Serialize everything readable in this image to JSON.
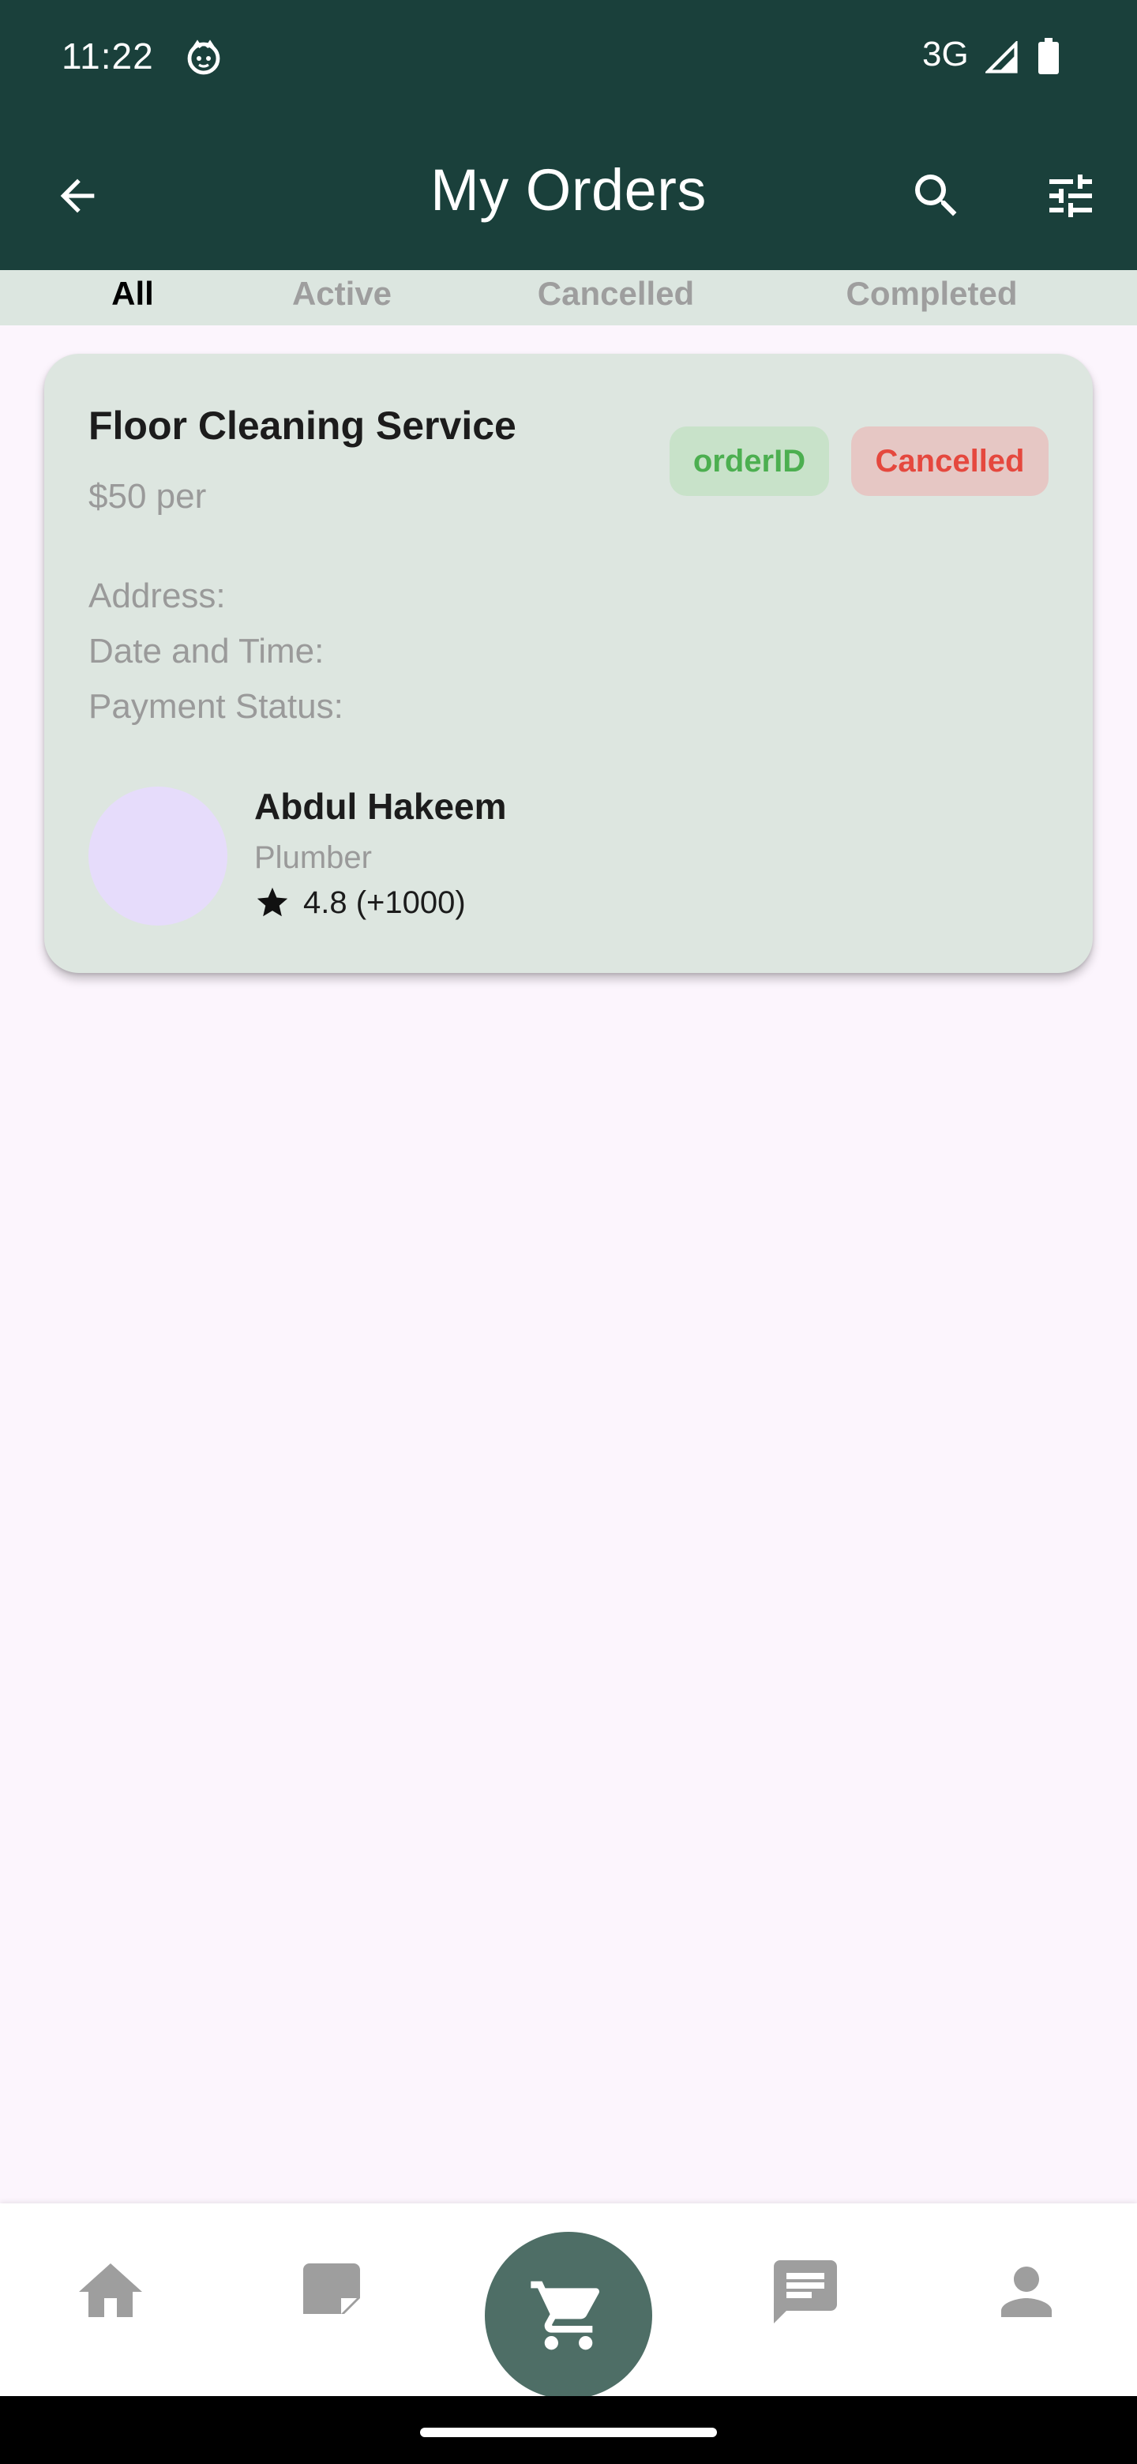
{
  "status_bar": {
    "time": "11:22",
    "network": "3G",
    "icons": [
      "face-icon",
      "signal-icon",
      "battery-icon"
    ]
  },
  "app_bar": {
    "title": "My Orders",
    "icons": [
      "back-arrow-icon",
      "search-icon",
      "filter-sliders-icon"
    ]
  },
  "tabs": [
    {
      "label": "All",
      "active": true
    },
    {
      "label": "Active",
      "active": false
    },
    {
      "label": "Cancelled",
      "active": false
    },
    {
      "label": "Completed",
      "active": false
    }
  ],
  "order": {
    "service_name": "Floor Cleaning Service",
    "price": "$50 per",
    "order_id_badge": "orderID",
    "status_badge": "Cancelled",
    "address_label": "Address:",
    "datetime_label": "Date and Time:",
    "payment_label": "Payment Status:",
    "provider": {
      "name": "Abdul Hakeem",
      "role": "Plumber",
      "rating": "4.8 (+1000)"
    }
  },
  "bottom_nav": {
    "items": [
      "home-icon",
      "document-icon",
      "cart-icon",
      "chat-icon",
      "profile-icon"
    ],
    "selected": "cart-icon"
  },
  "colors": {
    "primary_dark": "#1a403b",
    "tab_bar": "#dce6e0",
    "card": "#dde6e0",
    "page_bg": "#fcf5fd",
    "order_badge_bg": "#c8e2c9",
    "order_badge_text": "#4caf50",
    "cancelled_badge_bg": "#e6c7c4",
    "cancelled_badge_text": "#e5483e",
    "nav_selected": "#4e6e66"
  }
}
